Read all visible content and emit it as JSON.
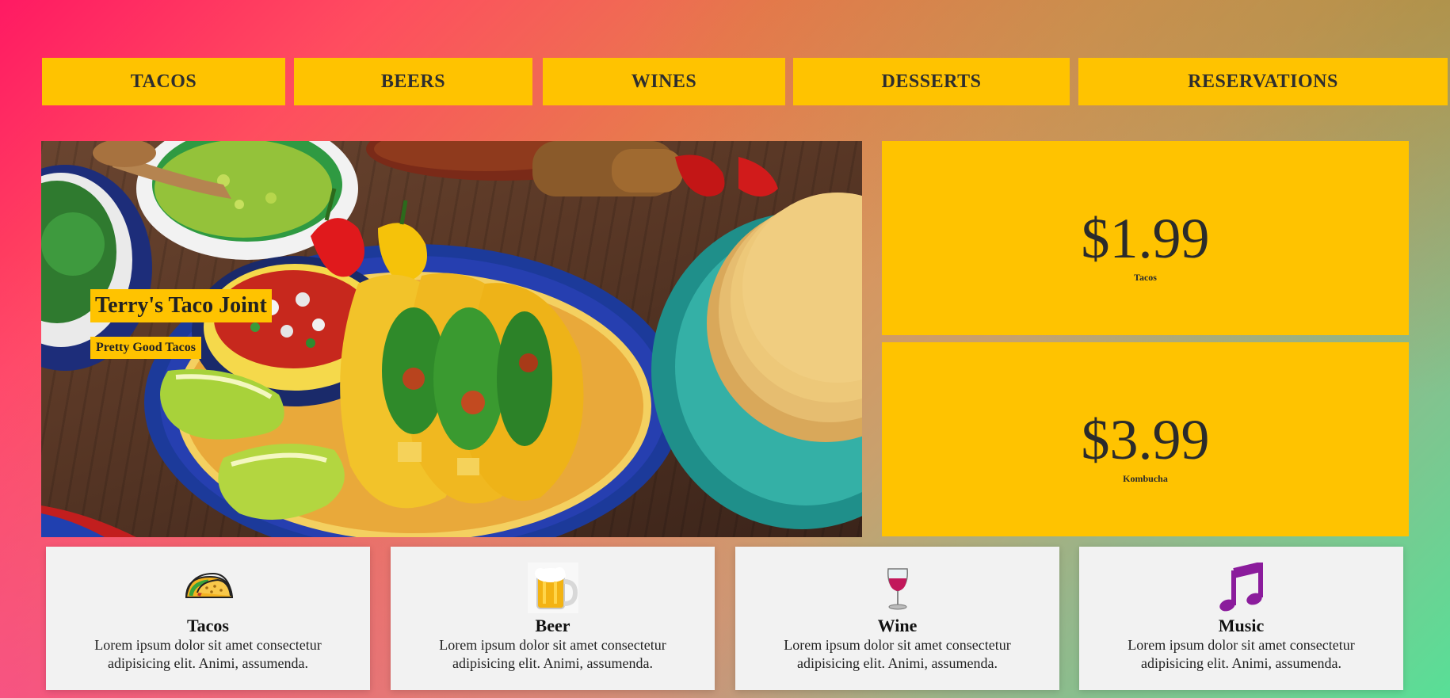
{
  "nav": {
    "items": [
      {
        "label": "TACOS"
      },
      {
        "label": "BEERS"
      },
      {
        "label": "WINES"
      },
      {
        "label": "DESSERTS"
      },
      {
        "label": "RESERVATIONS"
      }
    ]
  },
  "hero": {
    "title": "Terry's Taco Joint",
    "subtitle": "Pretty Good Tacos"
  },
  "prices": [
    {
      "price": "$1.99",
      "label": "Tacos"
    },
    {
      "price": "$3.99",
      "label": "Kombucha"
    }
  ],
  "features": [
    {
      "icon": "taco-icon",
      "title": "Tacos",
      "text": "Lorem ipsum dolor sit amet consectetur adipisicing elit. Animi, assumenda."
    },
    {
      "icon": "beer-mug-icon",
      "title": "Beer",
      "text": "Lorem ipsum dolor sit amet consectetur adipisicing elit. Animi, assumenda."
    },
    {
      "icon": "wine-glass-icon",
      "title": "Wine",
      "text": "Lorem ipsum dolor sit amet consectetur adipisicing elit. Animi, assumenda."
    },
    {
      "icon": "music-notes-icon",
      "title": "Music",
      "text": "Lorem ipsum dolor sit amet consectetur adipisicing elit. Animi, assumenda."
    }
  ],
  "colors": {
    "accent": "#ffc300",
    "card": "#f2f2f2",
    "text": "#222222",
    "music_icon": "#8b1c9c"
  }
}
